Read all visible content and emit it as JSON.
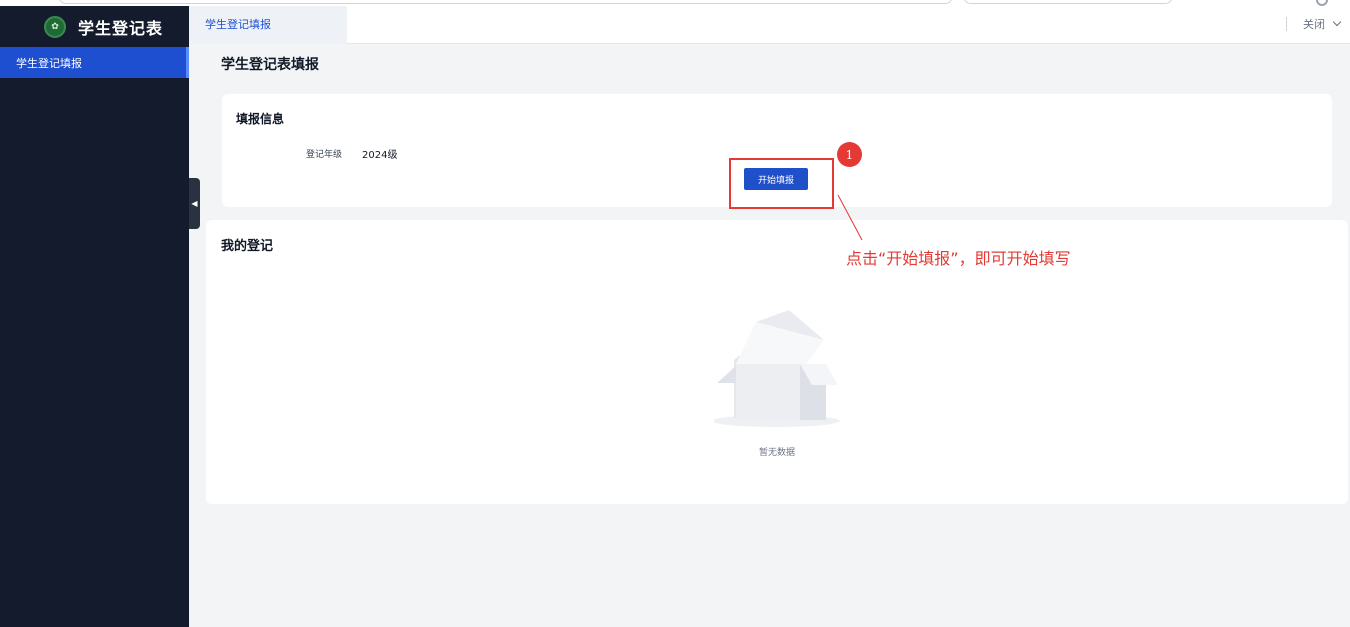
{
  "app": {
    "title": "学生登记表"
  },
  "sidebar": {
    "items": [
      {
        "label": "学生登记填报"
      }
    ]
  },
  "header": {
    "tab_label": "学生登记填报",
    "close_label": "关闭"
  },
  "page": {
    "title": "学生登记表填报"
  },
  "info_card": {
    "title": "填报信息",
    "field_label": "登记年级",
    "field_value": "2024级",
    "button_label": "开始填报"
  },
  "tutorial": {
    "step_number": "1",
    "annotation": "点击“开始填报”，即可开始填写",
    "color": "#e53935"
  },
  "records_card": {
    "title": "我的登记",
    "empty_text": "暂无数据"
  },
  "colors": {
    "sidebar_bg": "#141b2d",
    "accent": "#1e4fd1"
  }
}
